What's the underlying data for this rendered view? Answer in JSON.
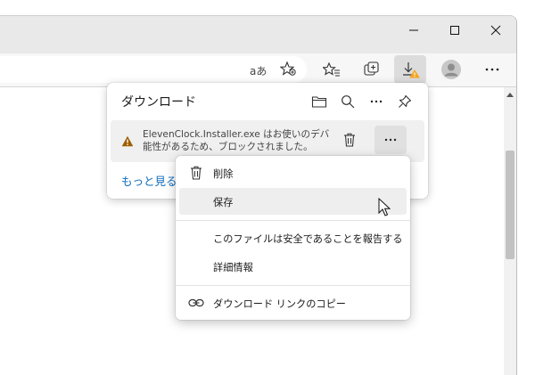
{
  "toolbar": {
    "read_aloud_label": "aあ"
  },
  "downloads_panel": {
    "title": "ダウンロード",
    "item": {
      "line1": "ElevenClock.Installer.exe はお使いのデバイ",
      "line2": "能性があるため、ブロックされました。",
      "warning_color": "#9d5d00"
    },
    "see_more": "もっと見る"
  },
  "context_menu": {
    "items": [
      {
        "label": "削除",
        "icon": "trash-icon"
      },
      {
        "label": "保存",
        "icon": ""
      },
      {
        "label": "このファイルは安全であることを報告する",
        "icon": ""
      },
      {
        "label": "詳細情報",
        "icon": ""
      },
      {
        "label": "ダウンロード リンクのコピー",
        "icon": "link-icon"
      }
    ]
  },
  "colors": {
    "accent": "#0f6cbd",
    "titlebar": "#e9e9e9",
    "warning": "#9d5d00"
  }
}
